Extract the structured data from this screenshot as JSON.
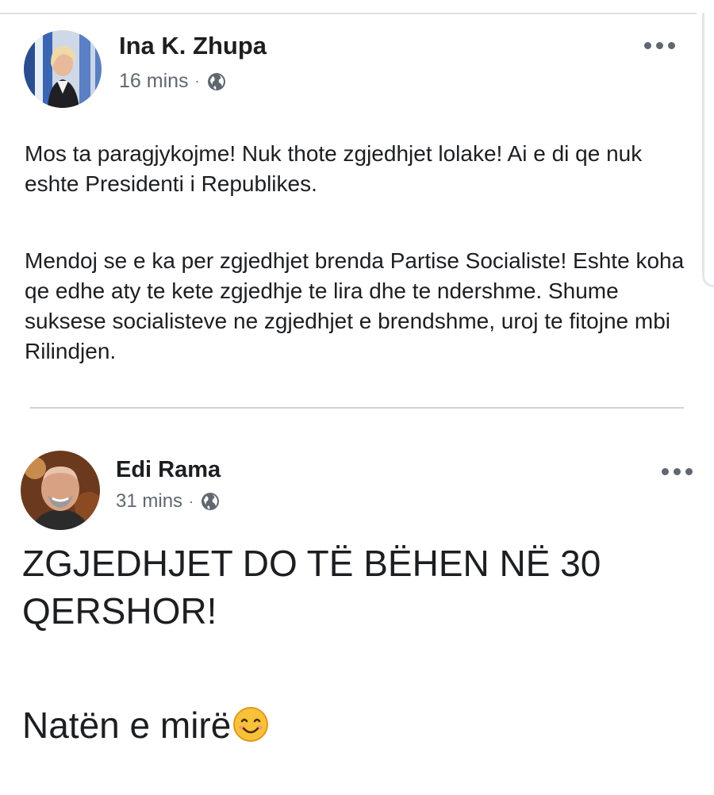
{
  "posts": [
    {
      "author": "Ina K. Zhupa",
      "time": "16 mins",
      "separator": "·",
      "privacy_icon": "globe-icon",
      "paragraphs": [
        "Mos ta paragjykojme! Nuk thote zgjedhjet lolake! Ai e di qe nuk eshte Presidenti i Republikes.",
        "Mendoj se e ka per zgjedhjet brenda Partise Socialiste! Eshte koha qe edhe aty te kete zgjedhje te lira dhe te ndershme. Shume suksese socialisteve ne zgjedhjet e brendshme, uroj te fitojne mbi Rilindjen."
      ]
    },
    {
      "author": "Edi Rama",
      "time": "31 mins",
      "separator": "·",
      "privacy_icon": "globe-icon",
      "paragraphs": [
        "ZGJEDHJET DO TË BËHEN NË 30 QERSHOR!",
        "Natën e mirë"
      ],
      "emoji": "smiling-face-emoji"
    }
  ],
  "colors": {
    "text": "#1c1e21",
    "meta": "#606770",
    "divider": "#d0d2d6"
  }
}
